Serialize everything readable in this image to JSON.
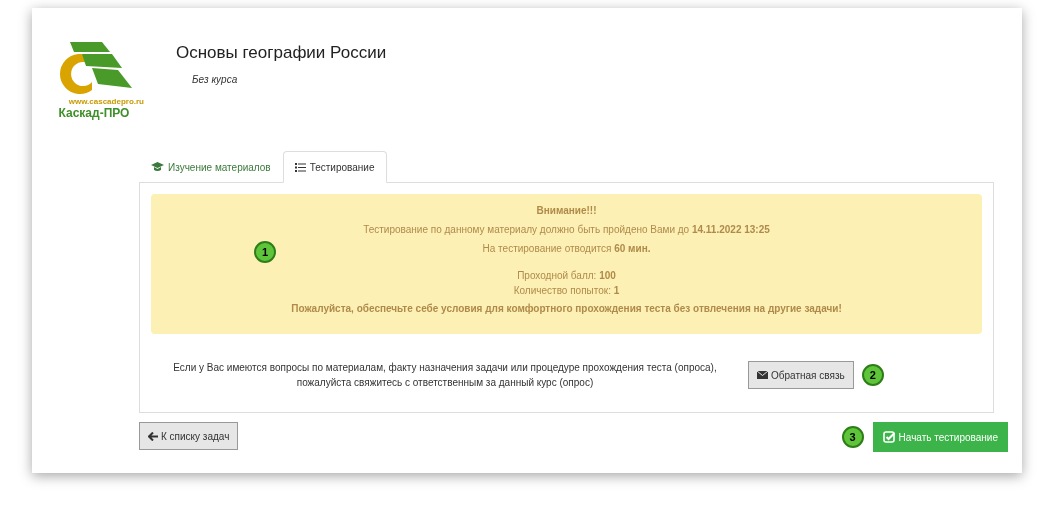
{
  "logo": {
    "url": "www.cascadepro.ru",
    "name": "Каскад-ПРО"
  },
  "header": {
    "title": "Основы географии России",
    "subtitle": "Без курса"
  },
  "tabs": [
    {
      "label": "Изучение материалов",
      "kind": "materials",
      "selected": false
    },
    {
      "label": "Тестирование",
      "kind": "testing",
      "selected": true
    }
  ],
  "alert": {
    "badge": "1",
    "lines": [
      "**Внимание!!!**",
      "Тестирование по данному материалу должно быть пройдено Вами до **14.11.2022 13:25**",
      "На тестирование отводится **60 мин.**",
      "Проходной балл: **100**",
      "Количество попыток: **1**",
      "**Пожалуйста, обеспечьте себе условия для комфортного прохождения теста без отвлечения на другие задачи!**"
    ]
  },
  "contact": {
    "text": "Если у Вас имеются вопросы по материалам, факту назначения задачи или процедуре прохождения теста (опроса), пожалуйста свяжитесь с ответственным за данный курс (опрос)",
    "button": "Обратная связь",
    "badge": "2"
  },
  "back_button": "К списку задач",
  "start_button": {
    "label": "Начать тестирование",
    "badge": "3"
  }
}
